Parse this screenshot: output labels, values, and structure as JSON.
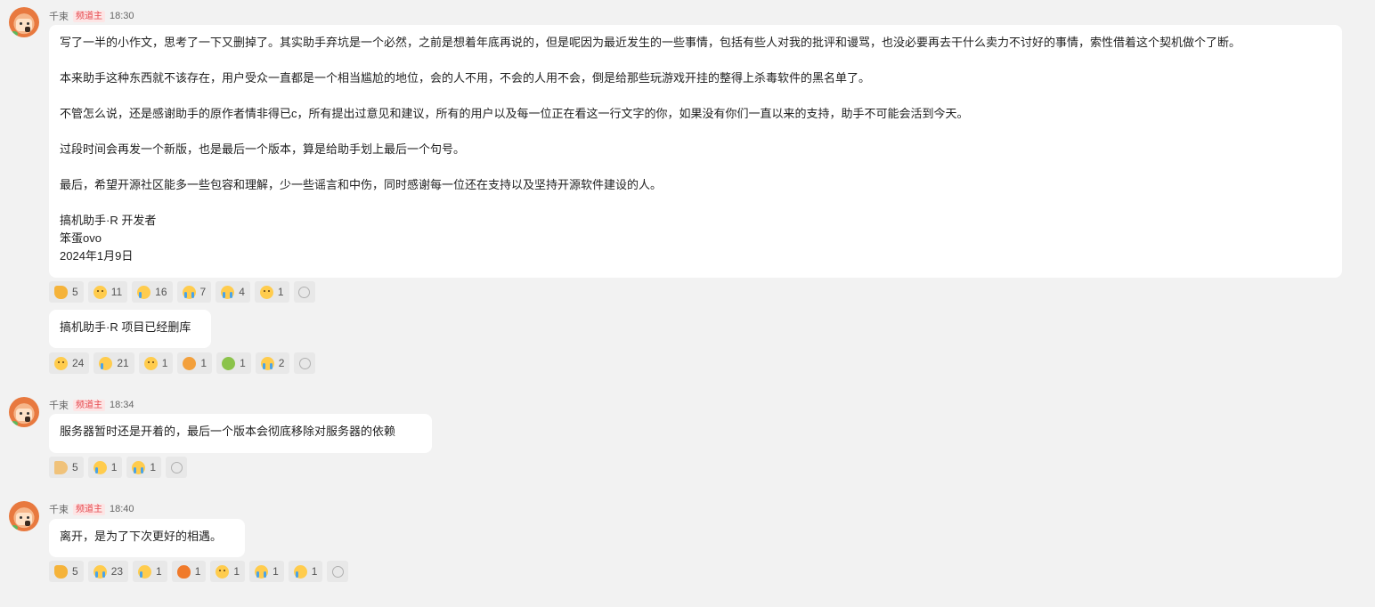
{
  "messages": [
    {
      "user": "千束",
      "role": "频道主",
      "time": "18:30",
      "paragraphs": [
        "写了一半的小作文，思考了一下又删掉了。其实助手弃坑是一个必然，之前是想着年底再说的，但是呢因为最近发生的一些事情，包括有些人对我的批评和谩骂，也没必要再去干什么卖力不讨好的事情，索性借着这个契机做个了断。",
        "本来助手这种东西就不该存在，用户受众一直都是一个相当尴尬的地位，会的人不用，不会的人用不会，倒是给那些玩游戏开挂的整得上杀毒软件的黑名单了。",
        "不管怎么说，还是感谢助手的原作者情非得已c，所有提出过意见和建议，所有的用户以及每一位正在看这一行文字的你，如果没有你们一直以来的支持，助手不可能会活到今天。",
        "过段时间会再发一个新版，也是最后一个版本，算是给助手划上最后一个句号。",
        "最后，希望开源社区能多一些包容和理解，少一些谣言和中伤，同时感谢每一位还在支持以及坚持开源软件建设的人。"
      ],
      "signature": [
        "搞机助手·R 开发者",
        "笨蛋ovo",
        "2024年1月9日"
      ],
      "reactions": [
        {
          "icon": "thumbs-up-icon",
          "count": "5"
        },
        {
          "icon": "pleading-face-icon",
          "count": "11"
        },
        {
          "icon": "crying-face-icon",
          "count": "16"
        },
        {
          "icon": "tears-of-joy-icon",
          "count": "7"
        },
        {
          "icon": "sobbing-face-icon",
          "count": "4"
        },
        {
          "icon": "puppy-face-icon",
          "count": "1"
        }
      ]
    },
    {
      "text": "搞机助手·R 项目已经删库",
      "reactions": [
        {
          "icon": "pleading-face-icon",
          "count": "24"
        },
        {
          "icon": "crying-face-icon",
          "count": "21"
        },
        {
          "icon": "sad-face-icon",
          "count": "1"
        },
        {
          "icon": "angry-face-icon",
          "count": "1"
        },
        {
          "icon": "green-figure-icon",
          "count": "1"
        },
        {
          "icon": "sobbing-face-icon",
          "count": "2"
        }
      ]
    },
    {
      "user": "千束",
      "role": "频道主",
      "time": "18:34",
      "text": "服务器暂时还是开着的，最后一个版本会彻底移除对服务器的依赖",
      "reactions": [
        {
          "icon": "folded-hands-icon",
          "count": "5"
        },
        {
          "icon": "smiling-tear-icon",
          "count": "1"
        },
        {
          "icon": "tears-of-joy-icon",
          "count": "1"
        }
      ]
    },
    {
      "user": "千束",
      "role": "频道主",
      "time": "18:40",
      "text": "离开，是为了下次更好的相遇。",
      "reactions": [
        {
          "icon": "thumbs-up-icon",
          "count": "5"
        },
        {
          "icon": "sobbing-face-icon",
          "count": "23"
        },
        {
          "icon": "crying-face-icon",
          "count": "1"
        },
        {
          "icon": "fire-icon",
          "count": "1"
        },
        {
          "icon": "pleading-face-icon",
          "count": "1"
        },
        {
          "icon": "tears-of-joy-icon",
          "count": "1"
        },
        {
          "icon": "smiling-tear-icon",
          "count": "1"
        }
      ]
    }
  ]
}
